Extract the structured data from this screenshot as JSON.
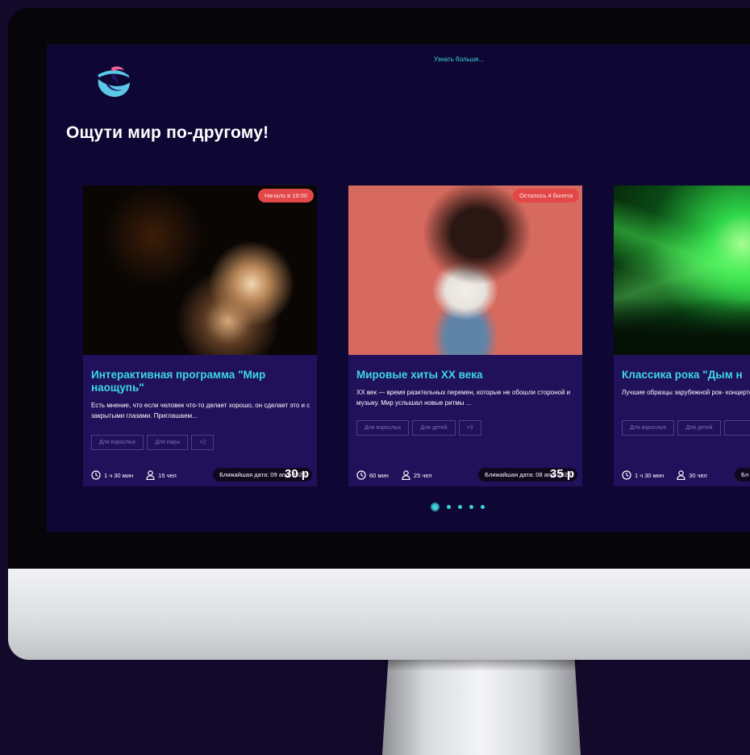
{
  "header": {
    "learn_more": "Узнать больше...",
    "title": "Ощути мир по-другому!"
  },
  "cards": [
    {
      "title": "Интерактивная программа \"Мир наощупь\"",
      "description": "Есть мнение, что если человек что-то делает хорошо, он сделает это и с закрытыми глазами. Приглашаем...",
      "status_badge": "Начало в 19:00",
      "date_badge": "Ближайшая дата: 09 апр. 2023",
      "tags": [
        "Для взрослых",
        "Для пары",
        "+2"
      ],
      "duration": "1 ч 30 мин",
      "people": "15 чел",
      "price": "30 р"
    },
    {
      "title": "Мировые хиты XX века",
      "description": "XX век — время разительных перемен, которые не обошли стороной и музыку. Мир услышал новые ритмы ...",
      "status_badge": "Осталось 4 билета",
      "date_badge": "Ближайшая дата: 08 апр. 2023",
      "tags": [
        "Для взрослых",
        "Для детей",
        "+3"
      ],
      "duration": "60 мин",
      "people": "25 чел",
      "price": "35 р"
    },
    {
      "title": "Классика рока \"Дым н",
      "description": "Лучшие образцы зарубежной рок- концертов MTV Unplugged в полн",
      "date_badge": "Бл",
      "tags": [
        "Для взрослых",
        "Для детей",
        ""
      ],
      "duration": "1 ч 30 мин",
      "people": "30 чел"
    }
  ],
  "carousel": {
    "total": 5,
    "active_index": 0
  },
  "colors": {
    "page_bg": "#130a2b",
    "screen_bg": "#0f0733",
    "card_bg": "#21105a",
    "accent": "#3bd8e6",
    "badge_red": "#e24848",
    "logo_blue": "#5bc8e8",
    "logo_pink": "#ef5f95",
    "logo_purple": "#1f1570"
  },
  "icons": {
    "clock": "clock-icon",
    "person": "person-icon",
    "logo": "bird-logo"
  }
}
